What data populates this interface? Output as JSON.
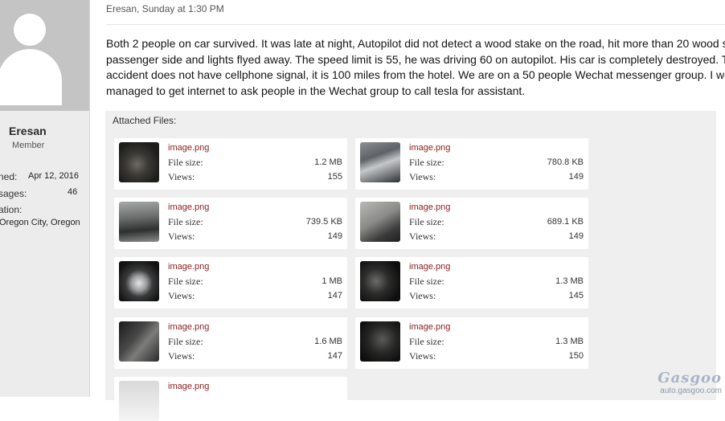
{
  "author": {
    "name": "Eresan",
    "title": "Member",
    "fields": [
      {
        "label": "ned:",
        "value": "Apr 12, 2016"
      },
      {
        "label": "sages:",
        "value": "46"
      },
      {
        "label": "ation:",
        "value": ""
      },
      {
        "label": "",
        "value": "Oregon City, Oregon"
      }
    ]
  },
  "post": {
    "meta": "Eresan, Sunday at 1:30 PM",
    "lines": [
      "Both 2 people on car survived. It was late at night, Autopilot did not detect a wood stake on the road, hit more than 20 wood s",
      "passenger side and lights flyed away. The speed limit is 55, he was driving 60 on autopilot. His car is completely destroyed. Th",
      "accident does not have cellphone signal, it is 100 miles from the hotel. We are on a 50 people Wechat messenger group. I woke",
      "managed to get internet to ask people in the Wechat group to call tesla for assistant."
    ]
  },
  "attachments": {
    "header": "Attached Files:",
    "size_label": "File size:",
    "views_label": "Views:",
    "files": [
      {
        "name": "image.png",
        "size": "1.2 MB",
        "views": "155"
      },
      {
        "name": "image.png",
        "size": "780.8 KB",
        "views": "149"
      },
      {
        "name": "image.png",
        "size": "739.5 KB",
        "views": "149"
      },
      {
        "name": "image.png",
        "size": "689.1 KB",
        "views": "149"
      },
      {
        "name": "image.png",
        "size": "1 MB",
        "views": "147"
      },
      {
        "name": "image.png",
        "size": "1.3 MB",
        "views": "145"
      },
      {
        "name": "image.png",
        "size": "1.6 MB",
        "views": "147"
      },
      {
        "name": "image.png",
        "size": "1.3 MB",
        "views": "150"
      },
      {
        "name": "image.png",
        "size": "",
        "views": ""
      }
    ]
  },
  "watermark": {
    "logo": "Gasgoo",
    "url": "auto.gasgoo.com"
  }
}
